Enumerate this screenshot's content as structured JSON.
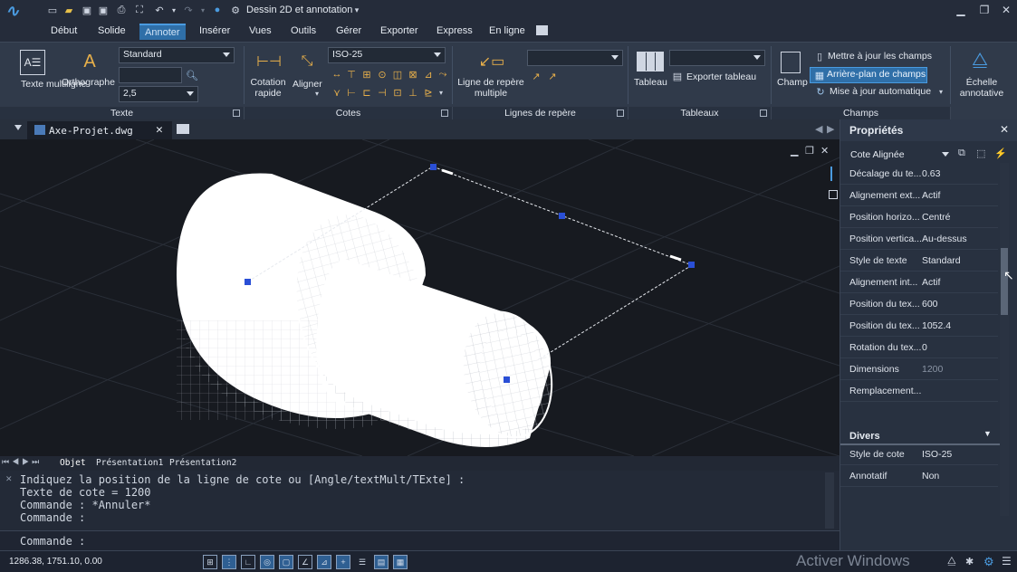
{
  "title_bar": {
    "app_name": "Dessin 2D et annotation",
    "window_controls": [
      "minimize-icon",
      "restore-icon",
      "close-icon"
    ]
  },
  "menu": {
    "items": [
      "Début",
      "Solide",
      "Annoter",
      "Insérer",
      "Vues",
      "Outils",
      "Gérer",
      "Exporter",
      "Express",
      "En ligne"
    ],
    "active": "Annoter"
  },
  "ribbon": {
    "texte": {
      "group_label": "Texte",
      "texte_multiligne": "Texte multiligne",
      "orthographe": "Orthographe",
      "style": "Standard",
      "height": "2,5"
    },
    "cotes": {
      "group_label": "Cotes",
      "cotation_rapide": "Cotation rapide",
      "aligner": "Aligner",
      "style": "ISO-25"
    },
    "lignes": {
      "group_label": "Lignes de repère",
      "ligne_repere": "Ligne de repère multiple"
    },
    "tableaux": {
      "group_label": "Tableaux",
      "tableau": "Tableau",
      "exporter": "Exporter tableau"
    },
    "champs": {
      "group_label": "Champs",
      "champ": "Champ",
      "mettre_a_jour": "Mettre à jour les champs",
      "arriere_plan": "Arrière-plan de champs",
      "mise_a_jour_auto": "Mise à jour automatique"
    },
    "echelle": "Échelle annotative"
  },
  "doc_tab": {
    "name": "Axe-Projet.dwg"
  },
  "layout_tabs": [
    "Objet",
    "Présentation1",
    "Présentation2"
  ],
  "command_line": {
    "history": [
      "Indiquez la position de la ligne de cote ou [Angle/textMult/TExte] :",
      "Texte de cote = 1200",
      "Commande : *Annuler*",
      "Commande :"
    ],
    "prompt": "Commande :"
  },
  "status_bar": {
    "coordinates": "1286.38, 1751.10, 0.00",
    "watermark": "Activer Windows"
  },
  "properties": {
    "title": "Propriétés",
    "object_type": "Cote Alignée",
    "rows": [
      {
        "key": "Décalage du te...",
        "value": "0.63"
      },
      {
        "key": "Alignement ext...",
        "value": "Actif"
      },
      {
        "key": "Position horizo...",
        "value": "Centré"
      },
      {
        "key": "Position vertica...",
        "value": "Au-dessus"
      },
      {
        "key": "Style de texte",
        "value": "Standard"
      },
      {
        "key": "Alignement int...",
        "value": "Actif"
      },
      {
        "key": "Position du tex...",
        "value": "600"
      },
      {
        "key": "Position du tex...",
        "value": "1052.4"
      },
      {
        "key": "Rotation du tex...",
        "value": "0"
      },
      {
        "key": "Dimensions",
        "value": "1200"
      },
      {
        "key": "Remplacement...",
        "value": ""
      }
    ],
    "section_divers": "Divers",
    "divers_rows": [
      {
        "key": "Style de cote",
        "value": "ISO-25"
      },
      {
        "key": "Annotatif",
        "value": "Non"
      }
    ]
  }
}
